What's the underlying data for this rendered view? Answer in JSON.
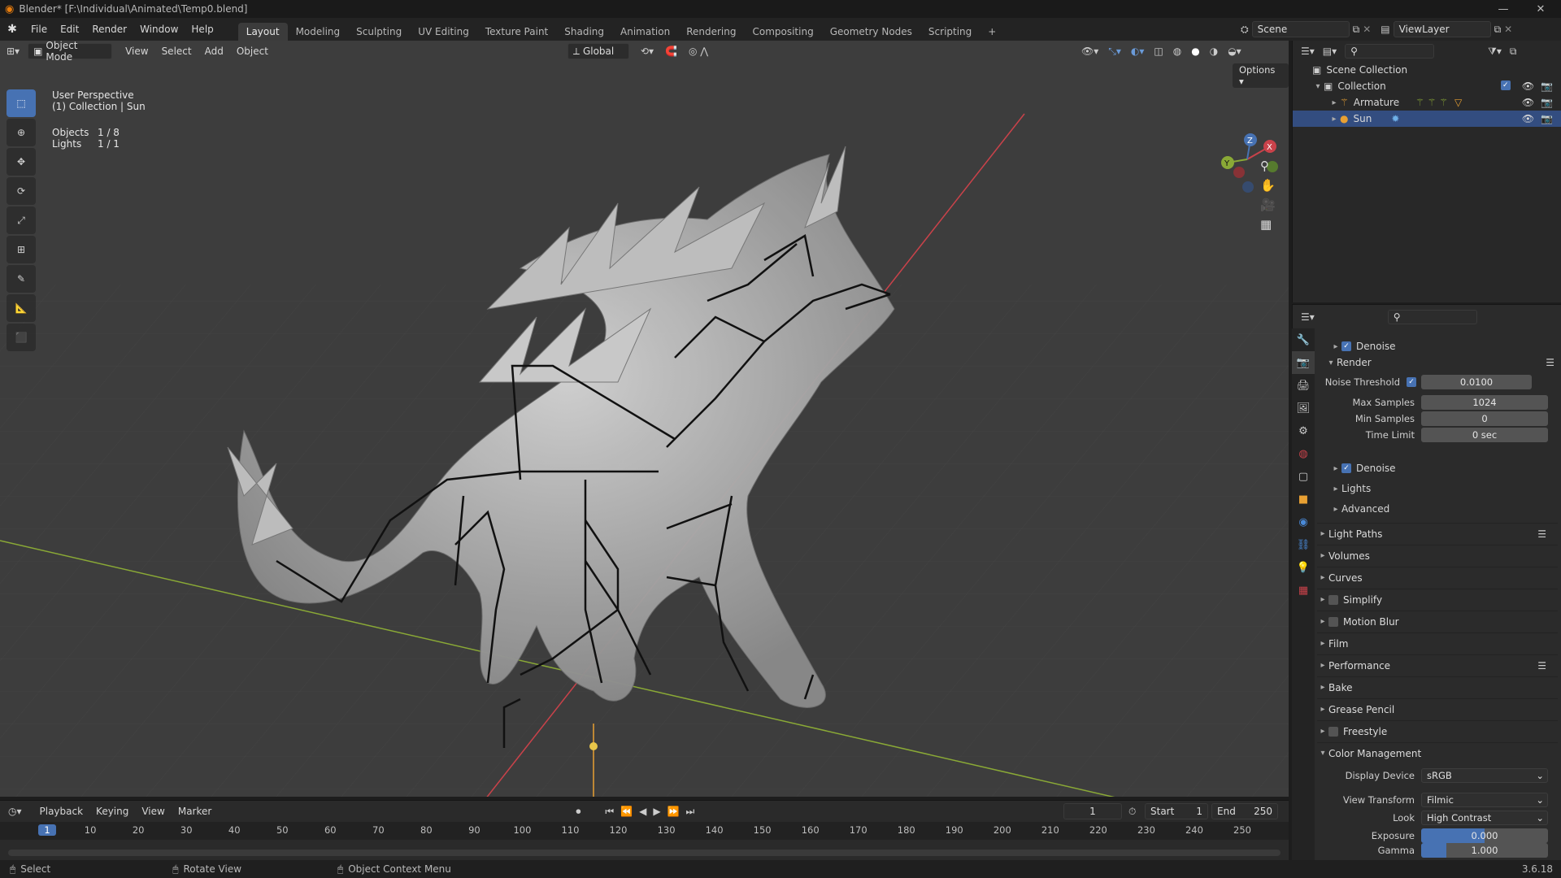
{
  "window": {
    "title": "Blender* [F:\\Individual\\Animated\\Temp0.blend]",
    "minimize": "—",
    "maximize": "❐",
    "close": "✕"
  },
  "topbar": {
    "menus": [
      "File",
      "Edit",
      "Render",
      "Window",
      "Help"
    ],
    "workspaces": [
      "Layout",
      "Modeling",
      "Sculpting",
      "UV Editing",
      "Texture Paint",
      "Shading",
      "Animation",
      "Rendering",
      "Compositing",
      "Geometry Nodes",
      "Scripting"
    ],
    "active_workspace": "Layout",
    "add_tab": "+",
    "scene": "Scene",
    "view_layer": "ViewLayer"
  },
  "viewport": {
    "mode": "Object Mode",
    "menus": [
      "View",
      "Select",
      "Add",
      "Object"
    ],
    "orientation": "Global",
    "options": "Options",
    "overlay_title": "User Perspective",
    "overlay_subtitle": "(1) Collection | Sun",
    "stats": [
      {
        "label": "Objects",
        "value": "1 / 8"
      },
      {
        "label": "Lights",
        "value": "1 / 1"
      }
    ],
    "gizmo_axes": {
      "x": "X",
      "y": "Y",
      "z": "Z"
    },
    "colors": {
      "bg": "#3d3d3d",
      "x_axis": "#c9424a",
      "y_axis": "#8aa936",
      "z_axis": "#e8a033",
      "active": "#4772b3"
    }
  },
  "outliner": {
    "scene_collection": "Scene Collection",
    "collection": "Collection",
    "items": [
      {
        "name": "Armature",
        "icon": "armature-icon"
      },
      {
        "name": "Sun",
        "icon": "sun-icon"
      }
    ]
  },
  "properties": {
    "top_label": "Denoise",
    "render_label": "Render",
    "noise_threshold": {
      "label": "Noise Threshold",
      "value": "0.0100"
    },
    "max_samples": {
      "label": "Max Samples",
      "value": "1024"
    },
    "min_samples": {
      "label": "Min Samples",
      "value": "0"
    },
    "time_limit": {
      "label": "Time Limit",
      "value": "0 sec"
    },
    "sub_panels": [
      "Denoise",
      "Lights",
      "Advanced"
    ],
    "panels": [
      "Light Paths",
      "Volumes",
      "Curves",
      "Simplify",
      "Motion Blur",
      "Film",
      "Performance",
      "Bake",
      "Grease Pencil",
      "Freestyle",
      "Color Management"
    ],
    "display_device": {
      "label": "Display Device",
      "value": "sRGB"
    },
    "view_transform": {
      "label": "View Transform",
      "value": "Filmic"
    },
    "look": {
      "label": "Look",
      "value": "High Contrast"
    },
    "exposure": {
      "label": "Exposure",
      "value": "0.000"
    },
    "gamma": {
      "label": "Gamma",
      "value": "1.000"
    }
  },
  "timeline": {
    "menus": [
      "Playback",
      "Keying",
      "View",
      "Marker"
    ],
    "current_frame": "1",
    "start_label": "Start",
    "start": "1",
    "end_label": "End",
    "end": "250",
    "ticks": [
      "1",
      "10",
      "20",
      "30",
      "40",
      "50",
      "60",
      "70",
      "80",
      "90",
      "100",
      "110",
      "120",
      "130",
      "140",
      "150",
      "160",
      "170",
      "180",
      "190",
      "200",
      "210",
      "220",
      "230",
      "240",
      "250"
    ]
  },
  "statusbar": {
    "select": "Select",
    "rotate": "Rotate View",
    "context": "Object Context Menu",
    "version": "3.6.18"
  }
}
